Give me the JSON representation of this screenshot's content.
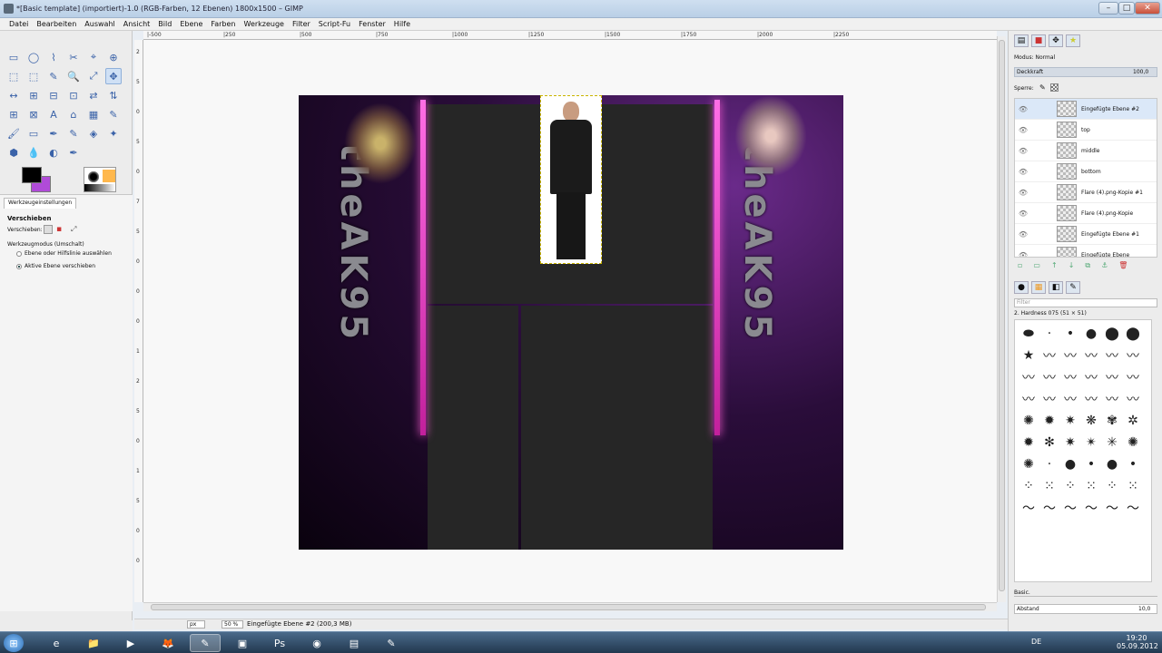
{
  "window": {
    "title": "*[Basic template] (importiert)-1.0 (RGB-Farben, 12 Ebenen) 1800x1500 – GIMP",
    "minimize": "–",
    "maximize": "□",
    "close": "✕"
  },
  "menu": [
    "Datei",
    "Bearbeiten",
    "Auswahl",
    "Ansicht",
    "Bild",
    "Ebene",
    "Farben",
    "Werkzeuge",
    "Filter",
    "Script-Fu",
    "Fenster",
    "Hilfe"
  ],
  "ruler": {
    "top_ticks": [
      "|-500",
      "|250",
      "|500",
      "|750",
      "|1000",
      "|1250",
      "|1500",
      "|1750",
      "|2000",
      "|2250"
    ],
    "left_ticks": [
      "2",
      "5",
      "0",
      "5",
      "0",
      "7",
      "5",
      "0",
      "0",
      "0",
      "1",
      "2",
      "5",
      "0",
      "1",
      "5",
      "0",
      "0"
    ]
  },
  "toolbox": {
    "tools": [
      "▭",
      "◯",
      "⌇",
      "✂",
      "⌖",
      "⊕",
      "⬚",
      "⬚",
      "✎",
      "🔍",
      "⤢",
      "✥",
      "↔",
      "⊞",
      "⊟",
      "⊡",
      "⇄",
      "⇅",
      "⊞",
      "⊠",
      "A",
      "⌂",
      "▦",
      "✎",
      "🖌",
      "▭",
      "✒",
      "✎",
      "◈",
      "✦",
      "⬢",
      "💧",
      "◐",
      "✒",
      "",
      ""
    ],
    "selected_index": 11
  },
  "tool_options": {
    "tab": "Werkzeugeinstellungen",
    "header": "Verschieben",
    "label_move": "Verschieben:",
    "label_mode": "Werkzeugmodus (Umschalt)",
    "radio1": "Ebene oder Hilfslinie auswählen",
    "radio2": "Aktive Ebene verschieben"
  },
  "canvas": {
    "side_text_left": "theAK95",
    "side_text_right": "theAK95"
  },
  "status": {
    "unit": "px",
    "zoom": "50 %",
    "message": "Eingefügte Ebene #2 (200,3 MB)"
  },
  "dock": {
    "mode_label": "Modus: Normal",
    "opacity_label": "Deckkraft",
    "opacity_value": "100,0",
    "lock_label": "Sperre:",
    "layers": [
      {
        "name": "Eingefügte Ebene #2",
        "selected": true
      },
      {
        "name": "top",
        "selected": false
      },
      {
        "name": "middle",
        "selected": false
      },
      {
        "name": "bottom",
        "selected": false
      },
      {
        "name": "Flare (4).png-Kopie #1",
        "selected": false
      },
      {
        "name": "Flare (4).png-Kopie",
        "selected": false
      },
      {
        "name": "Eingefügte Ebene #1",
        "selected": false
      },
      {
        "name": "Eingefügte Ebene",
        "selected": false
      }
    ],
    "filter_placeholder": "Filter",
    "brush_label": "2. Hardness 075 (51 × 51)",
    "preset_label": "Basic.",
    "spacing_label": "Abstand",
    "spacing_value": "10,0"
  },
  "taskbar": {
    "lang": "DE",
    "time": "19:20",
    "date": "05.09.2012",
    "apps": [
      "⊞",
      "e",
      "📁",
      "▶",
      "🦊",
      "✎",
      "▣",
      "Ps",
      "◉",
      "▤",
      "✎"
    ]
  },
  "colors": {
    "accent": "#3a62a8",
    "pink_glow": "#ff5cd8",
    "image_bg": "#2a0d3a",
    "panel_dark": "#262626",
    "fg_color": "#000000",
    "bg_color": "#b04bd8"
  }
}
